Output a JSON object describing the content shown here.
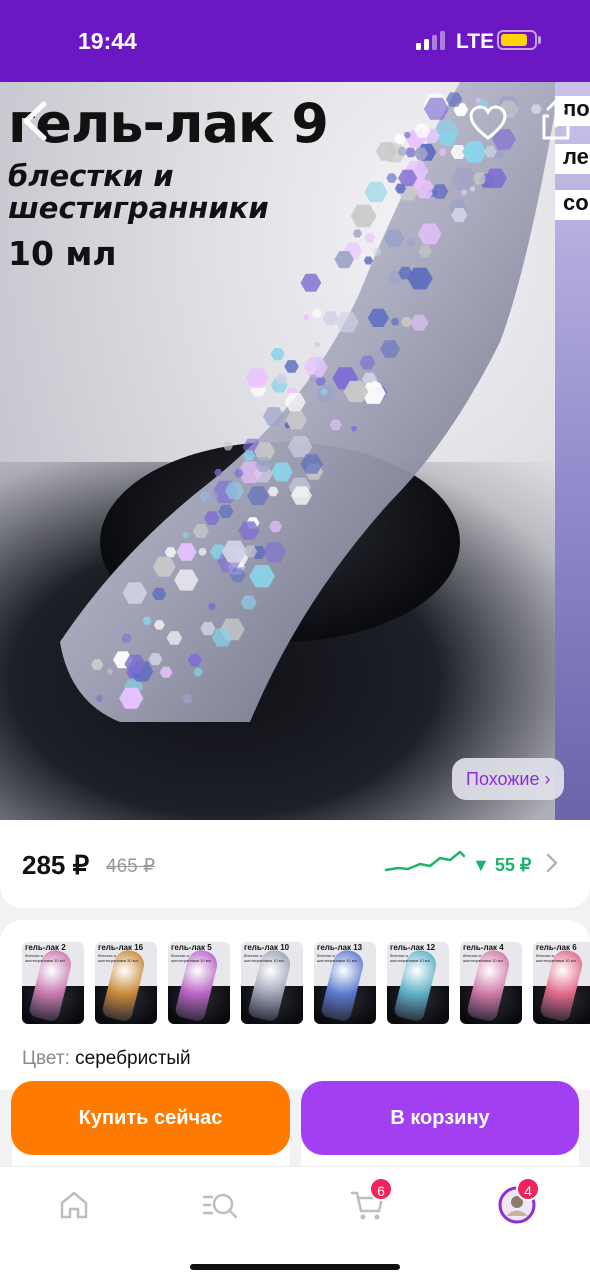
{
  "status_bar": {
    "time": "19:44",
    "network": "LTE"
  },
  "hero": {
    "title": "гель-лак 9",
    "subtitle": "блестки и шестигранники",
    "volume": "10 мл",
    "next_slide_tags": [
      "по",
      "ле",
      "со"
    ],
    "similar_button": "Похожие ›",
    "colors": {
      "nail_glitter": "#c9c9d8",
      "bottle": "#0b0c10"
    }
  },
  "price": {
    "current": "285 ₽",
    "old": "465 ₽",
    "drop": "▼ 55 ₽",
    "colors": {
      "drop": "#1db36b"
    }
  },
  "variants": {
    "thumbnails": [
      {
        "label": "гель-лак 2",
        "sub": "блестки и шестигранники 10 мл",
        "tint": "#c77ab0"
      },
      {
        "label": "гель-лак 16",
        "sub": "блестки и шестигранники 10 мл",
        "tint": "#c98a3a"
      },
      {
        "label": "гель-лак 5",
        "sub": "блестки и шестигранники 10 мл",
        "tint": "#b866c4"
      },
      {
        "label": "гель-лак 10",
        "sub": "блестки и шестигранники 10 мл",
        "tint": "#9fa4b8"
      },
      {
        "label": "гель-лак 13",
        "sub": "блестки и шестигранники 10 мл",
        "tint": "#5c7ad0"
      },
      {
        "label": "гель-лак 12",
        "sub": "блестки и шестигранники 10 мл",
        "tint": "#5fb0c8"
      },
      {
        "label": "гель-лак 4",
        "sub": "блестки и шестигранники 10 мл",
        "tint": "#d07aa8"
      },
      {
        "label": "гель-лак 6",
        "sub": "блестки и шестигранники 10 мл",
        "tint": "#e06a8a"
      }
    ],
    "color_label": "Цвет:",
    "color_value": "серебристый"
  },
  "actions": {
    "buy_now": "Купить сейчас",
    "add_to_cart": "В корзину",
    "colors": {
      "buy_now": "#ff7a00",
      "add_to_cart": "#a23ff0"
    }
  },
  "tab_bar": {
    "tabs": [
      {
        "name": "home",
        "icon": "home-icon"
      },
      {
        "name": "catalog",
        "icon": "catalog-search-icon"
      },
      {
        "name": "cart",
        "icon": "cart-icon",
        "badge": "6"
      },
      {
        "name": "profile",
        "icon": "avatar",
        "badge": "4"
      }
    ],
    "accent": "#8a2fd9"
  }
}
